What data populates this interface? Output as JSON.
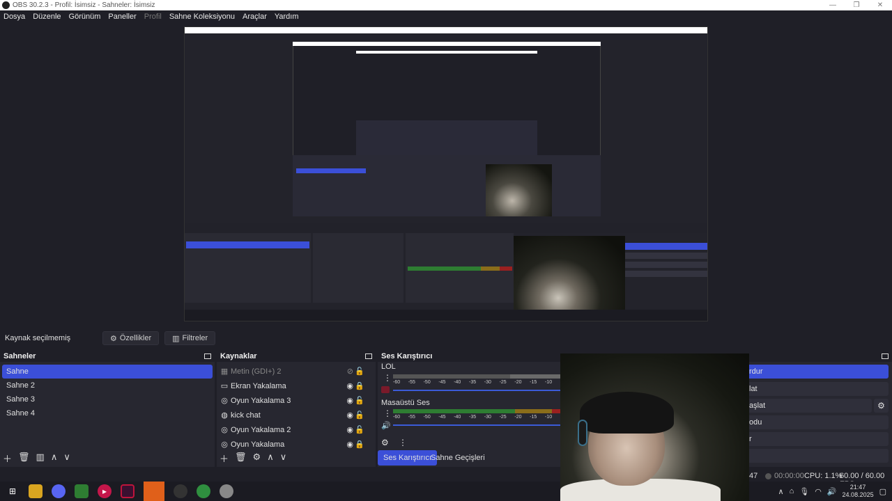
{
  "window": {
    "title": "OBS 30.2.3 - Profil: İsimsiz - Sahneler: İsimsiz"
  },
  "menu": [
    {
      "label": "Dosya",
      "enabled": true
    },
    {
      "label": "Düzenle",
      "enabled": true
    },
    {
      "label": "Görünüm",
      "enabled": true
    },
    {
      "label": "Paneller",
      "enabled": true
    },
    {
      "label": "Profil",
      "enabled": false
    },
    {
      "label": "Sahne Koleksiyonu",
      "enabled": true
    },
    {
      "label": "Araçlar",
      "enabled": true
    },
    {
      "label": "Yardım",
      "enabled": true
    }
  ],
  "source_toolbar": {
    "status": "Kaynak seçilmemiş",
    "properties": "Özellikler",
    "filters": "Filtreler"
  },
  "scenes": {
    "title": "Sahneler",
    "items": [
      "Sahne",
      "Sahne 2",
      "Sahne 3",
      "Sahne 4"
    ],
    "active_index": 0
  },
  "sources": {
    "title": "Kaynaklar",
    "items": [
      {
        "name": "Metin (GDI+) 2",
        "icon": "text-icon",
        "visible": false,
        "locked": false
      },
      {
        "name": "Ekran Yakalama",
        "icon": "monitor-icon",
        "visible": true,
        "locked": true
      },
      {
        "name": "Oyun Yakalama 3",
        "icon": "gamepad-icon",
        "visible": true,
        "locked": false
      },
      {
        "name": "kick chat",
        "icon": "globe-icon",
        "visible": true,
        "locked": false
      },
      {
        "name": "Oyun Yakalama 2",
        "icon": "gamepad-icon",
        "visible": true,
        "locked": false
      },
      {
        "name": "Oyun Yakalama",
        "icon": "gamepad-icon",
        "visible": true,
        "locked": true
      }
    ]
  },
  "mixer": {
    "title": "Ses Karıştırıcı",
    "channels": [
      {
        "name": "LOL",
        "muted": true
      },
      {
        "name": "Masaüstü Ses",
        "muted": false
      }
    ],
    "ticks": [
      "-60",
      "-55",
      "-50",
      "-45",
      "-40",
      "-35",
      "-30",
      "-25",
      "-20",
      "-15",
      "-10"
    ],
    "tabs": [
      "Ses Karıştırıcı",
      "Sahne Geçişleri"
    ]
  },
  "controls": {
    "buttons": [
      "rdur",
      "lat",
      "aşlat",
      "odu",
      "r",
      ""
    ]
  },
  "status": {
    "frames": "47",
    "rec_time": "00:00:00",
    "cpu": "CPU: 1.1%",
    "fps": "60.00 / 60.00 FPS"
  },
  "taskbar": {
    "time": "21:47",
    "date": "24.08.2025"
  },
  "colors": {
    "accent": "#3b4fd8",
    "bg": "#1f1f27",
    "panel": "#272730"
  }
}
